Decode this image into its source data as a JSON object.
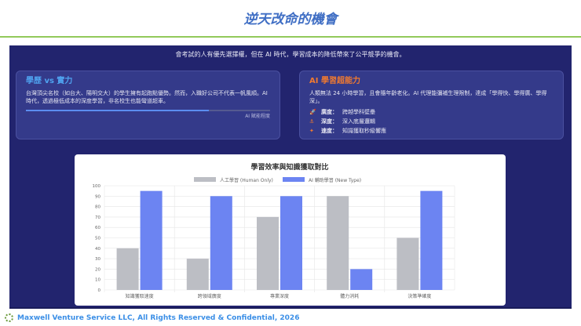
{
  "title": "逆天改命的機會",
  "subtitle": "會考試的人有優先選擇權，但在 AI 時代，學習成本的降低帶來了公平競爭的機會。",
  "left_card": {
    "heading": "學歷 vs 實力",
    "body": "台灣頂尖名校（如台大、陽明交大）的學生擁有起跑點優勢。然而，入職好公司不代表一帆風順。AI 時代，透過極低成本的深度學習，非名校生也能彎道超車。",
    "progress": 0.75,
    "progress_label": "AI 賦能程度",
    "heading_color": "#4fa3f0"
  },
  "right_card": {
    "heading": "AI 學習超能力",
    "body": "人類無法 24 小時學習，且會隨年齡老化。AI 代理能彌補生理限制，達成「學得快、學得廣、學得深」。",
    "heading_color": "#f07a30",
    "items": [
      {
        "icon": "rocket-icon",
        "glyph": "🚀",
        "label": "廣度：",
        "text": "跨越學科壁壘"
      },
      {
        "icon": "anchor-icon",
        "glyph": "⚓",
        "label": "深度：",
        "text": "深入底層邏輯"
      },
      {
        "icon": "bolt-icon",
        "glyph": "✦",
        "label": "速度：",
        "text": "知識獲取秒級響應"
      }
    ]
  },
  "chart_data": {
    "type": "bar",
    "title": "學習效率與知識獲取對比",
    "categories": [
      "知識獲取速度",
      "跨領域廣度",
      "專業深度",
      "體力消耗",
      "決策準確度"
    ],
    "series": [
      {
        "name": "人工學習 (Human Only)",
        "color": "#bcbec4",
        "values": [
          40,
          30,
          70,
          90,
          50
        ]
      },
      {
        "name": "AI 輔助學習 (New Type)",
        "color": "#6c84f2",
        "values": [
          95,
          90,
          90,
          20,
          95
        ]
      }
    ],
    "ylim": [
      0,
      100
    ],
    "yticks": [
      0,
      10,
      20,
      30,
      40,
      50,
      60,
      70,
      80,
      90,
      100
    ],
    "legend": "top",
    "grid": true
  },
  "footer": "Maxwell Venture Service LLC, All Rights Reserved & Confidential, 2026"
}
